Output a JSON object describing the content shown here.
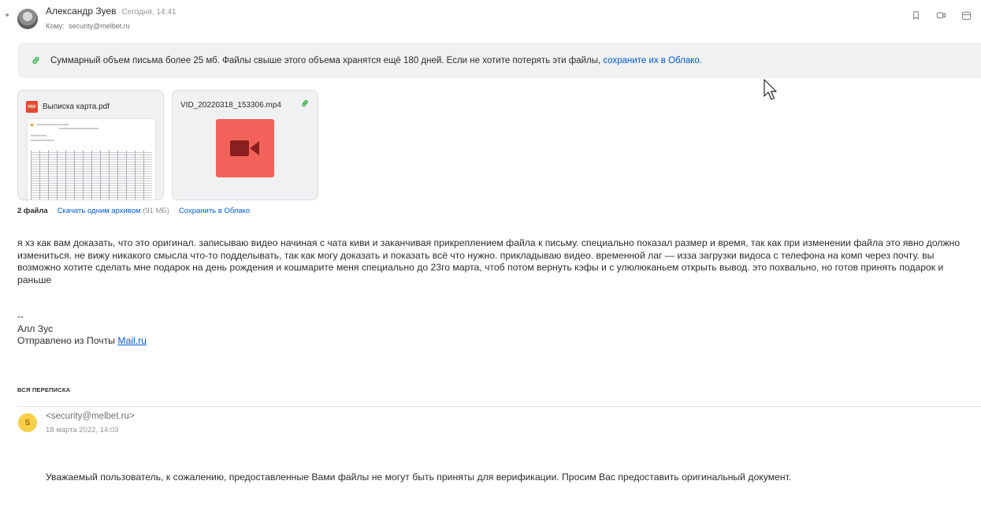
{
  "message": {
    "sender_name": "Александр Зуев",
    "date": "Сегодня, 14:41",
    "to_label": "Кому:",
    "to_address": "security@melbet.ru"
  },
  "toolbar": {
    "icons": [
      "bookmark-icon",
      "video-call-icon",
      "calendar-icon"
    ]
  },
  "notice": {
    "text": "Суммарный объем письма более 25 мб. Файлы свыше этого объема хранятся ещё 180 дней. Если не хотите потерять эти файлы,",
    "link": "сохраните их в Облако."
  },
  "attachments": {
    "items": [
      {
        "name": "Выписка карта.pdf",
        "type": "pdf",
        "badge": "PDF"
      },
      {
        "name": "VID_20220318_153306.mp4",
        "type": "video"
      }
    ],
    "count_label": "2 файла",
    "archive_label": "Скачать одним архивом",
    "archive_size": "(91 МБ)",
    "cloud_label": "Сохранить в Облако"
  },
  "body": {
    "text": "я хз как вам доказать, что это оригинал. записываю видео начиная с чата киви и заканчивая прикреплением файла к письму. специально показал размер и время, так как при изменении файла это явно должно измениться. не вижу никакого смысла что-то подделывать, так как могу доказать и показать всё что нужно. прикладываю видео. временной лаг — изза загрузки видоса с телефона на комп через почту. вы возможно хотите сделать мне подарок на день рождения и кошмарите меня специально до 23го марта, чтоб потом вернуть кэфы и с улюлюканьем открыть вывод. это похвально, но готов принять подарок и раньше"
  },
  "signature": {
    "dashes": "--",
    "name": "Алл Зус",
    "sent_from": "Отправлено из Почты",
    "link": "Mail.ru"
  },
  "thread": {
    "label": "ВСЯ ПЕРЕПИСКА",
    "reply": {
      "avatar_letter": "S",
      "from": "<security@melbet.ru>",
      "date": "18 марта 2022, 14:03",
      "text": "Уважаемый пользователь, к сожалению, предоставленные Вами файлы не могут быть приняты для верификации. Просим Вас предоставить оригинальный документ."
    }
  },
  "colors": {
    "link": "#005bd1",
    "notice_bg": "#f0f1f3",
    "pdf_red": "#e8482f",
    "video_red": "#f2625a",
    "attach_link_green": "#3fb34f",
    "reply_avatar": "#f8d049"
  }
}
